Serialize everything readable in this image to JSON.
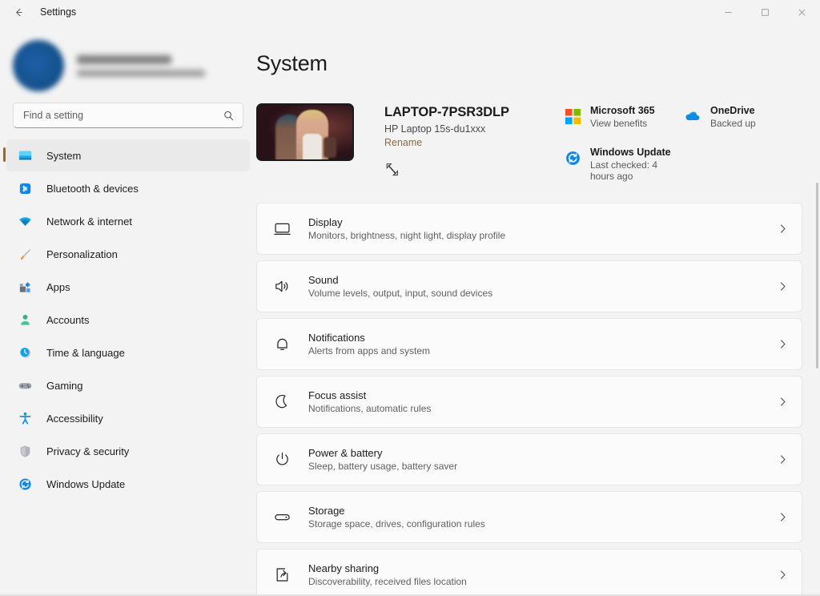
{
  "titlebar": {
    "back_label": "back-arrow",
    "title": "Settings",
    "minimize": "─",
    "maximize": "□",
    "close": "✕"
  },
  "sidebar": {
    "account": {
      "name_redacted": true,
      "email_redacted": true
    },
    "search": {
      "placeholder": "Find a setting",
      "value": "",
      "icon": "search-icon"
    },
    "items": [
      {
        "label": "System",
        "icon": "monitor-icon",
        "selected": true
      },
      {
        "label": "Bluetooth & devices",
        "icon": "bluetooth-icon",
        "selected": false
      },
      {
        "label": "Network & internet",
        "icon": "wifi-icon",
        "selected": false
      },
      {
        "label": "Personalization",
        "icon": "paintbrush-icon",
        "selected": false
      },
      {
        "label": "Apps",
        "icon": "apps-icon",
        "selected": false
      },
      {
        "label": "Accounts",
        "icon": "person-icon",
        "selected": false
      },
      {
        "label": "Time & language",
        "icon": "clock-icon",
        "selected": false
      },
      {
        "label": "Gaming",
        "icon": "gamepad-icon",
        "selected": false
      },
      {
        "label": "Accessibility",
        "icon": "accessibility-icon",
        "selected": false
      },
      {
        "label": "Privacy & security",
        "icon": "shield-icon",
        "selected": false
      },
      {
        "label": "Windows Update",
        "icon": "update-icon",
        "selected": false
      }
    ]
  },
  "main": {
    "page_title": "System",
    "device": {
      "name": "LAPTOP-7PSR3DLP",
      "model": "HP Laptop 15s-du1xxx",
      "rename_label": "Rename",
      "thumbnail": "desktop-wallpaper-thumbnail"
    },
    "status_cards": [
      {
        "title": "Microsoft 365",
        "subtitle": "View benefits",
        "icon": "microsoft-logo-icon"
      },
      {
        "title": "OneDrive",
        "subtitle": "Backed up",
        "icon": "onedrive-cloud-icon"
      },
      {
        "title": "Windows Update",
        "subtitle": "Last checked: 4 hours ago",
        "icon": "update-icon"
      }
    ],
    "settings_rows": [
      {
        "title": "Display",
        "subtitle": "Monitors, brightness, night light, display profile",
        "icon": "monitor-outline-icon"
      },
      {
        "title": "Sound",
        "subtitle": "Volume levels, output, input, sound devices",
        "icon": "speaker-icon"
      },
      {
        "title": "Notifications",
        "subtitle": "Alerts from apps and system",
        "icon": "bell-icon"
      },
      {
        "title": "Focus assist",
        "subtitle": "Notifications, automatic rules",
        "icon": "moon-icon"
      },
      {
        "title": "Power & battery",
        "subtitle": "Sleep, battery usage, battery saver",
        "icon": "power-icon"
      },
      {
        "title": "Storage",
        "subtitle": "Storage space, drives, configuration rules",
        "icon": "drive-icon"
      },
      {
        "title": "Nearby sharing",
        "subtitle": "Discoverability, received files location",
        "icon": "share-icon"
      }
    ],
    "chevron": "›"
  },
  "colors": {
    "accent": "#8a6a43",
    "window_bg": "#f3f3f3",
    "card_bg": "#fbfbfb",
    "selected_nav_bg": "#eaeaea"
  }
}
